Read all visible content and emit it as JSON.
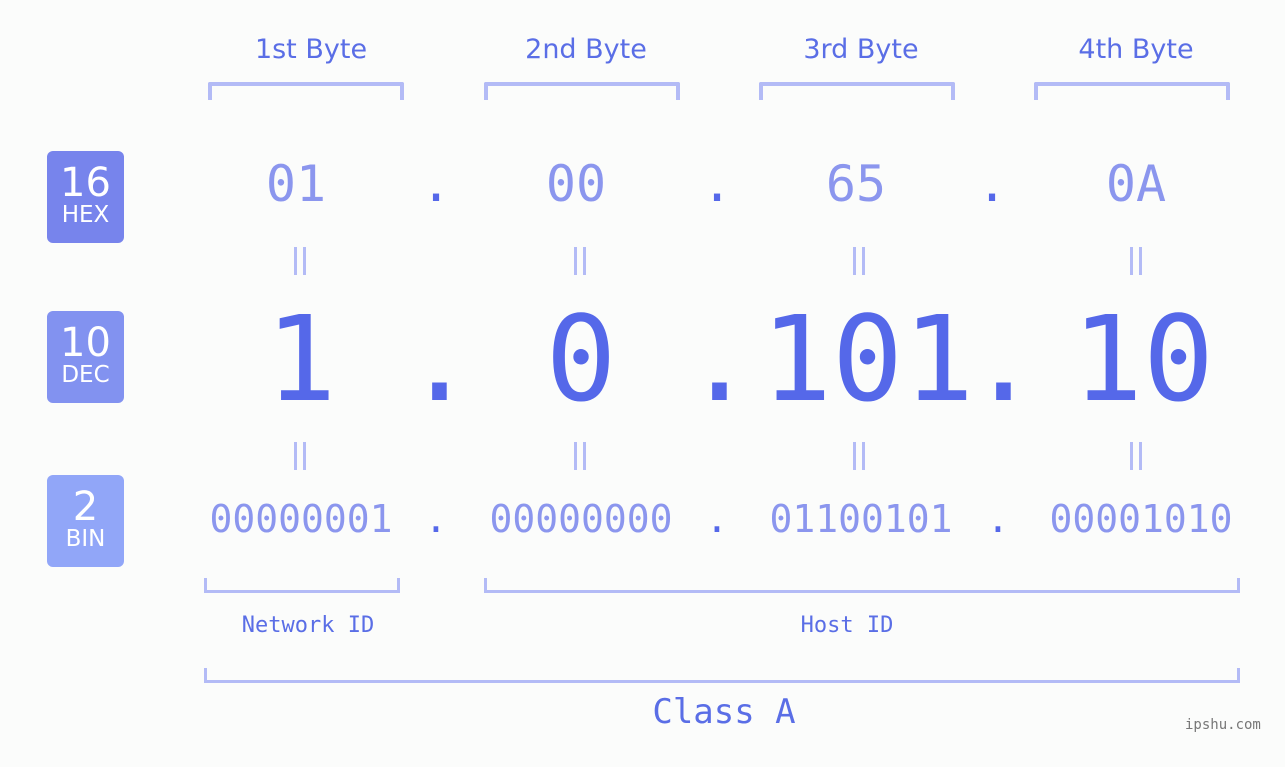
{
  "byte_headers": [
    "1st Byte",
    "2nd Byte",
    "3rd Byte",
    "4th Byte"
  ],
  "badges": [
    {
      "base": "16",
      "name": "HEX",
      "color": "#7784ec"
    },
    {
      "base": "10",
      "name": "DEC",
      "color": "#8292f0"
    },
    {
      "base": "2",
      "name": "BIN",
      "color": "#91a6f8"
    }
  ],
  "hex_octets": [
    "01",
    "00",
    "65",
    "0A"
  ],
  "dec_octets": [
    "1",
    "0",
    "101",
    "10"
  ],
  "bin_octets": [
    "00000001",
    "00000000",
    "01100101",
    "00001010"
  ],
  "separator": ".",
  "equals_sign": "=",
  "network_label": "Network ID",
  "host_label": "Host ID",
  "class_label": "Class A",
  "watermark": "ipshu.com",
  "colors": {
    "accent": "#5568e9",
    "bracket": "#b3bbf6",
    "light_value": "#8b96ee"
  }
}
